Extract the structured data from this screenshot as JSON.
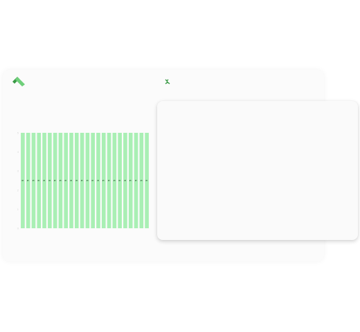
{
  "brand": {
    "logo_icon": "green-chevron-logo-icon",
    "sparkle_icon": "green-sparkle-icon",
    "colors": {
      "logo_dark": "#3a9a46",
      "logo_light": "#6fcf7a",
      "bar": "#a9efb4",
      "bar_label": "#2f5a35"
    }
  },
  "chart_data": {
    "type": "bar",
    "categories": [
      "",
      "",
      "",
      "",
      "",
      "",
      "",
      "",
      "",
      "",
      "",
      "",
      "",
      "",
      "",
      "",
      "",
      "",
      "",
      "",
      "",
      "",
      "",
      ""
    ],
    "values": [
      5,
      5,
      5,
      5,
      5,
      5,
      5,
      5,
      5,
      5,
      5,
      5,
      5,
      5,
      5,
      5,
      5,
      5,
      5,
      5,
      5,
      5,
      5,
      5
    ],
    "ylim": [
      0,
      5
    ],
    "yticks": [
      0,
      1,
      2,
      3,
      4,
      5
    ],
    "grid": false,
    "title": "",
    "xlabel": "",
    "ylabel": ""
  }
}
